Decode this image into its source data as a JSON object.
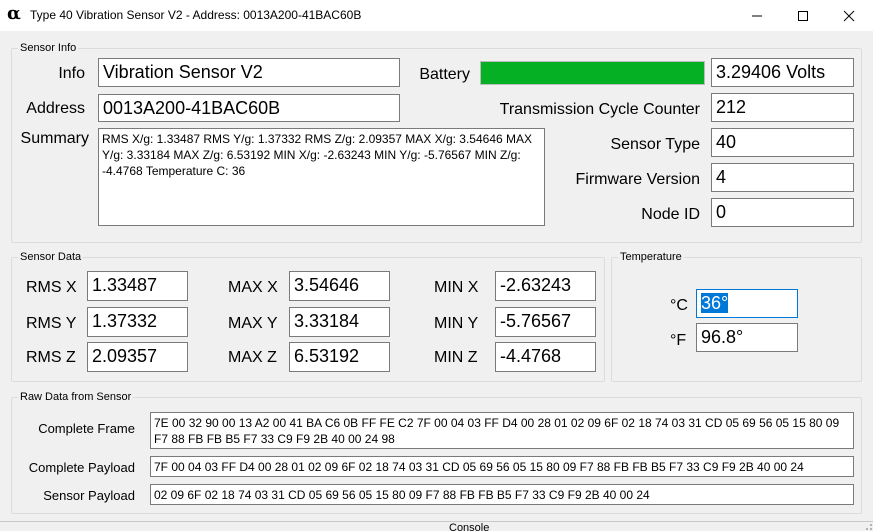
{
  "window": {
    "title": "Type 40 Vibration Sensor V2 - Address: 0013A200-41BAC60B",
    "app_icon_glyph": "α",
    "controls": {
      "minimize": "minimize-icon",
      "maximize": "maximize-icon",
      "close": "close-icon"
    }
  },
  "sensor_info": {
    "group_title": "Sensor Info",
    "info_label": "Info",
    "info_value": "Vibration Sensor V2",
    "address_label": "Address",
    "address_value": "0013A200-41BAC60B",
    "summary_label": "Summary",
    "summary_value": "RMS X/g: 1.33487 RMS Y/g: 1.37332 RMS Z/g: 2.09357 MAX X/g: 3.54646 MAX Y/g: 3.33184 MAX Z/g: 6.53192 MIN X/g: -2.63243 MIN Y/g: -5.76567 MIN Z/g: -4.4768 Temperature C: 36",
    "battery_label": "Battery",
    "battery_level": 1.0,
    "battery_color": "#06b025",
    "battery_value": "3.29406 Volts",
    "tx_counter_label": "Transmission Cycle Counter",
    "tx_counter_value": "212",
    "sensor_type_label": "Sensor Type",
    "sensor_type_value": "40",
    "firmware_label": "Firmware Version",
    "firmware_value": "4",
    "node_id_label": "Node ID",
    "node_id_value": "0"
  },
  "sensor_data": {
    "group_title": "Sensor Data",
    "rms_x_label": "RMS X",
    "rms_x_value": "1.33487",
    "rms_y_label": "RMS Y",
    "rms_y_value": "1.37332",
    "rms_z_label": "RMS Z",
    "rms_z_value": "2.09357",
    "max_x_label": "MAX X",
    "max_x_value": "3.54646",
    "max_y_label": "MAX Y",
    "max_y_value": "3.33184",
    "max_z_label": "MAX Z",
    "max_z_value": "6.53192",
    "min_x_label": "MIN X",
    "min_x_value": "-2.63243",
    "min_y_label": "MIN Y",
    "min_y_value": "-5.76567",
    "min_z_label": "MIN Z",
    "min_z_value": "-4.4768"
  },
  "temperature": {
    "group_title": "Temperature",
    "celsius_label": "°C",
    "celsius_value": "36°",
    "fahrenheit_label": "°F",
    "fahrenheit_value": "96.8°"
  },
  "raw_data": {
    "group_title": "Raw Data from Sensor",
    "complete_frame_label": "Complete Frame",
    "complete_frame_value": "7E 00 32 90 00 13 A2 00 41 BA C6 0B FF FE C2 7F 00 04 03 FF D4 00 28 01 02 09 6F 02 18 74 03 31 CD 05 69 56 05 15 80 09 F7 88 FB FB B5 F7 33 C9 F9 2B 40 00 24 98",
    "complete_payload_label": "Complete Payload",
    "complete_payload_value": "7F 00 04 03 FF D4 00 28 01 02 09 6F 02 18 74 03 31 CD 05 69 56 05 15 80 09 F7 88 FB FB B5 F7 33 C9 F9 2B 40 00 24",
    "sensor_payload_label": "Sensor Payload",
    "sensor_payload_value": "02 09 6F 02 18 74 03 31 CD 05 69 56 05 15 80 09 F7 88 FB FB B5 F7 33 C9 F9 2B 40 00 24"
  },
  "background_tab_label": "Console"
}
